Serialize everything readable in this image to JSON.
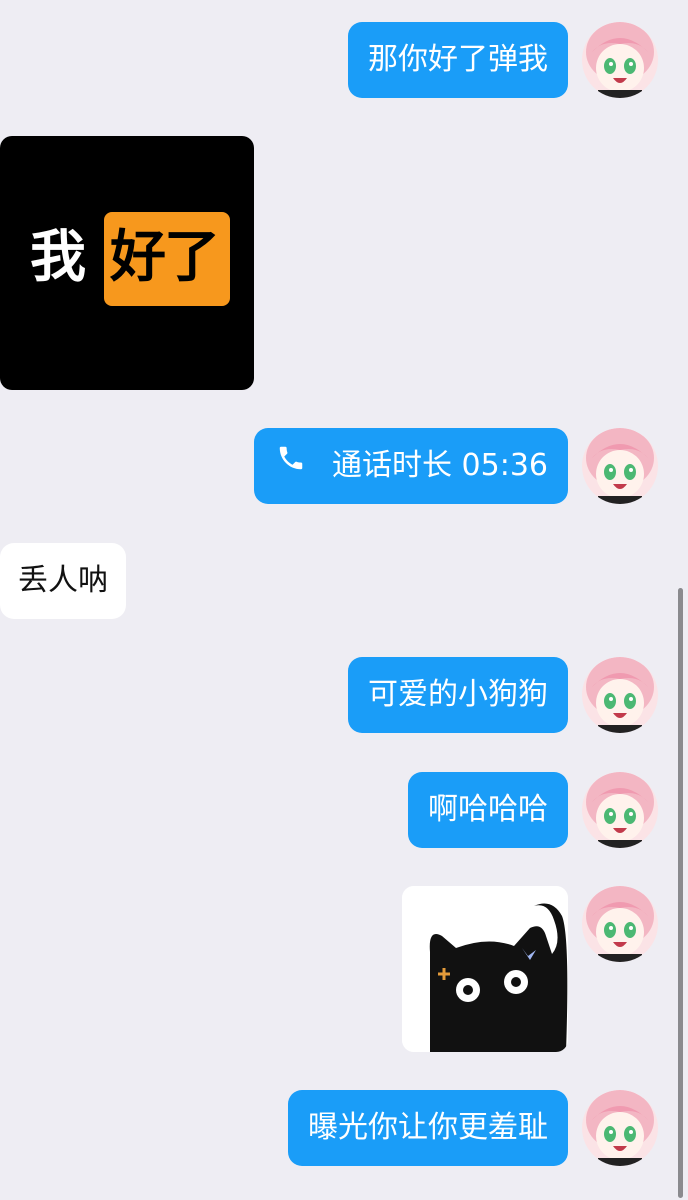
{
  "messages": {
    "m1": "那你好了弹我",
    "m2_sticker_text": [
      "我",
      "好了"
    ],
    "m3_call": "通话时长 05:36",
    "m4": "丢人呐",
    "m5": "可爱的小狗狗",
    "m6": "啊哈哈哈",
    "m8": "曝光你让你更羞耻"
  },
  "icons": {
    "call": "phone-icon",
    "avatar": "anime-girl-avatar",
    "sticker_cat": "black-cat-sticker"
  },
  "colors": {
    "outgoing_bubble": "#1a9df8",
    "incoming_bubble": "#ffffff",
    "background": "#eeedf3",
    "sticker_orange": "#f7981d"
  }
}
